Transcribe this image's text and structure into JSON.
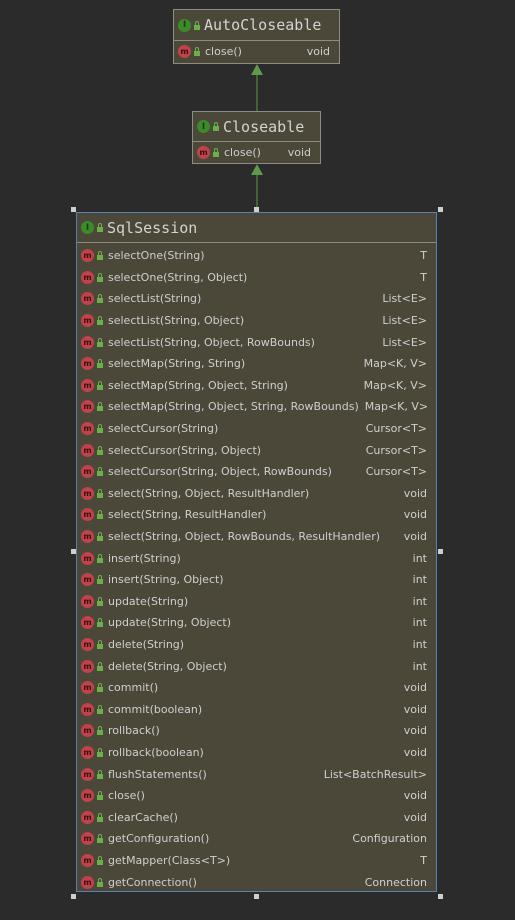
{
  "colors": {
    "background": "#2b2b2b",
    "box_fill": "#4b4739",
    "box_border": "#8e8c80",
    "selected_border": "#5a7fb5",
    "edge": "#5d9a4a",
    "interface_icon": "#3c8a2a",
    "method_icon": "#c0434b"
  },
  "icons": {
    "interface": "I",
    "method": "m"
  },
  "classes": [
    {
      "name": "AutoCloseable",
      "methods": [
        {
          "name": "close()",
          "returns": "void"
        }
      ]
    },
    {
      "name": "Closeable",
      "methods": [
        {
          "name": "close()",
          "returns": "void"
        }
      ]
    },
    {
      "name": "SqlSession",
      "methods": [
        {
          "name": "selectOne(String)",
          "returns": "T"
        },
        {
          "name": "selectOne(String, Object)",
          "returns": "T"
        },
        {
          "name": "selectList(String)",
          "returns": "List<E>"
        },
        {
          "name": "selectList(String, Object)",
          "returns": "List<E>"
        },
        {
          "name": "selectList(String, Object, RowBounds)",
          "returns": "List<E>"
        },
        {
          "name": "selectMap(String, String)",
          "returns": "Map<K, V>"
        },
        {
          "name": "selectMap(String, Object, String)",
          "returns": "Map<K, V>"
        },
        {
          "name": "selectMap(String, Object, String, RowBounds)",
          "returns": "Map<K, V>"
        },
        {
          "name": "selectCursor(String)",
          "returns": "Cursor<T>"
        },
        {
          "name": "selectCursor(String, Object)",
          "returns": "Cursor<T>"
        },
        {
          "name": "selectCursor(String, Object, RowBounds)",
          "returns": "Cursor<T>"
        },
        {
          "name": "select(String, Object, ResultHandler)",
          "returns": "void"
        },
        {
          "name": "select(String, ResultHandler)",
          "returns": "void"
        },
        {
          "name": "select(String, Object, RowBounds, ResultHandler)",
          "returns": "void"
        },
        {
          "name": "insert(String)",
          "returns": "int"
        },
        {
          "name": "insert(String, Object)",
          "returns": "int"
        },
        {
          "name": "update(String)",
          "returns": "int"
        },
        {
          "name": "update(String, Object)",
          "returns": "int"
        },
        {
          "name": "delete(String)",
          "returns": "int"
        },
        {
          "name": "delete(String, Object)",
          "returns": "int"
        },
        {
          "name": "commit()",
          "returns": "void"
        },
        {
          "name": "commit(boolean)",
          "returns": "void"
        },
        {
          "name": "rollback()",
          "returns": "void"
        },
        {
          "name": "rollback(boolean)",
          "returns": "void"
        },
        {
          "name": "flushStatements()",
          "returns": "List<BatchResult>"
        },
        {
          "name": "close()",
          "returns": "void"
        },
        {
          "name": "clearCache()",
          "returns": "void"
        },
        {
          "name": "getConfiguration()",
          "returns": "Configuration"
        },
        {
          "name": "getMapper(Class<T>)",
          "returns": "T"
        },
        {
          "name": "getConnection()",
          "returns": "Connection"
        }
      ]
    }
  ],
  "edges": [
    {
      "from": "Closeable",
      "to": "AutoCloseable",
      "kind": "extends"
    },
    {
      "from": "SqlSession",
      "to": "Closeable",
      "kind": "extends"
    }
  ]
}
